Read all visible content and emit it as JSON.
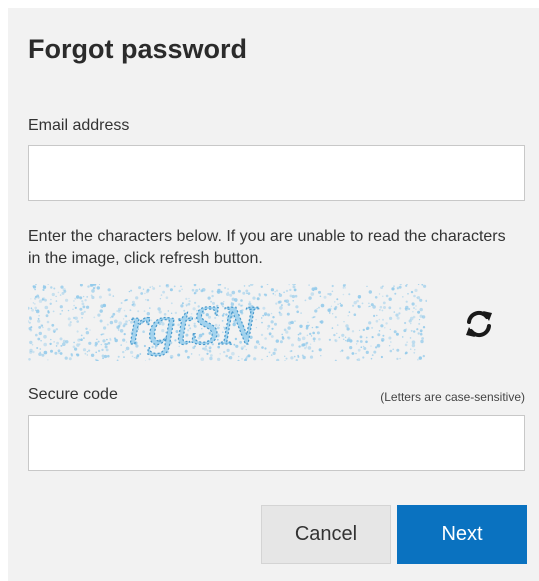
{
  "dialog": {
    "title": "Forgot password"
  },
  "email": {
    "label": "Email address",
    "value": "",
    "placeholder": ""
  },
  "instructions": "Enter the characters below. If you are unable to read the characters in the image, click refresh button.",
  "captcha": {
    "text": "rgtSN",
    "icon": "refresh-icon"
  },
  "secure_code": {
    "label": "Secure code",
    "hint": "(Letters are case-sensitive)",
    "value": "",
    "placeholder": ""
  },
  "buttons": {
    "cancel": "Cancel",
    "next": "Next"
  },
  "colors": {
    "panel_bg": "#f2f2f2",
    "primary": "#0a72c0",
    "captcha_ink": "#4aa3d6"
  }
}
